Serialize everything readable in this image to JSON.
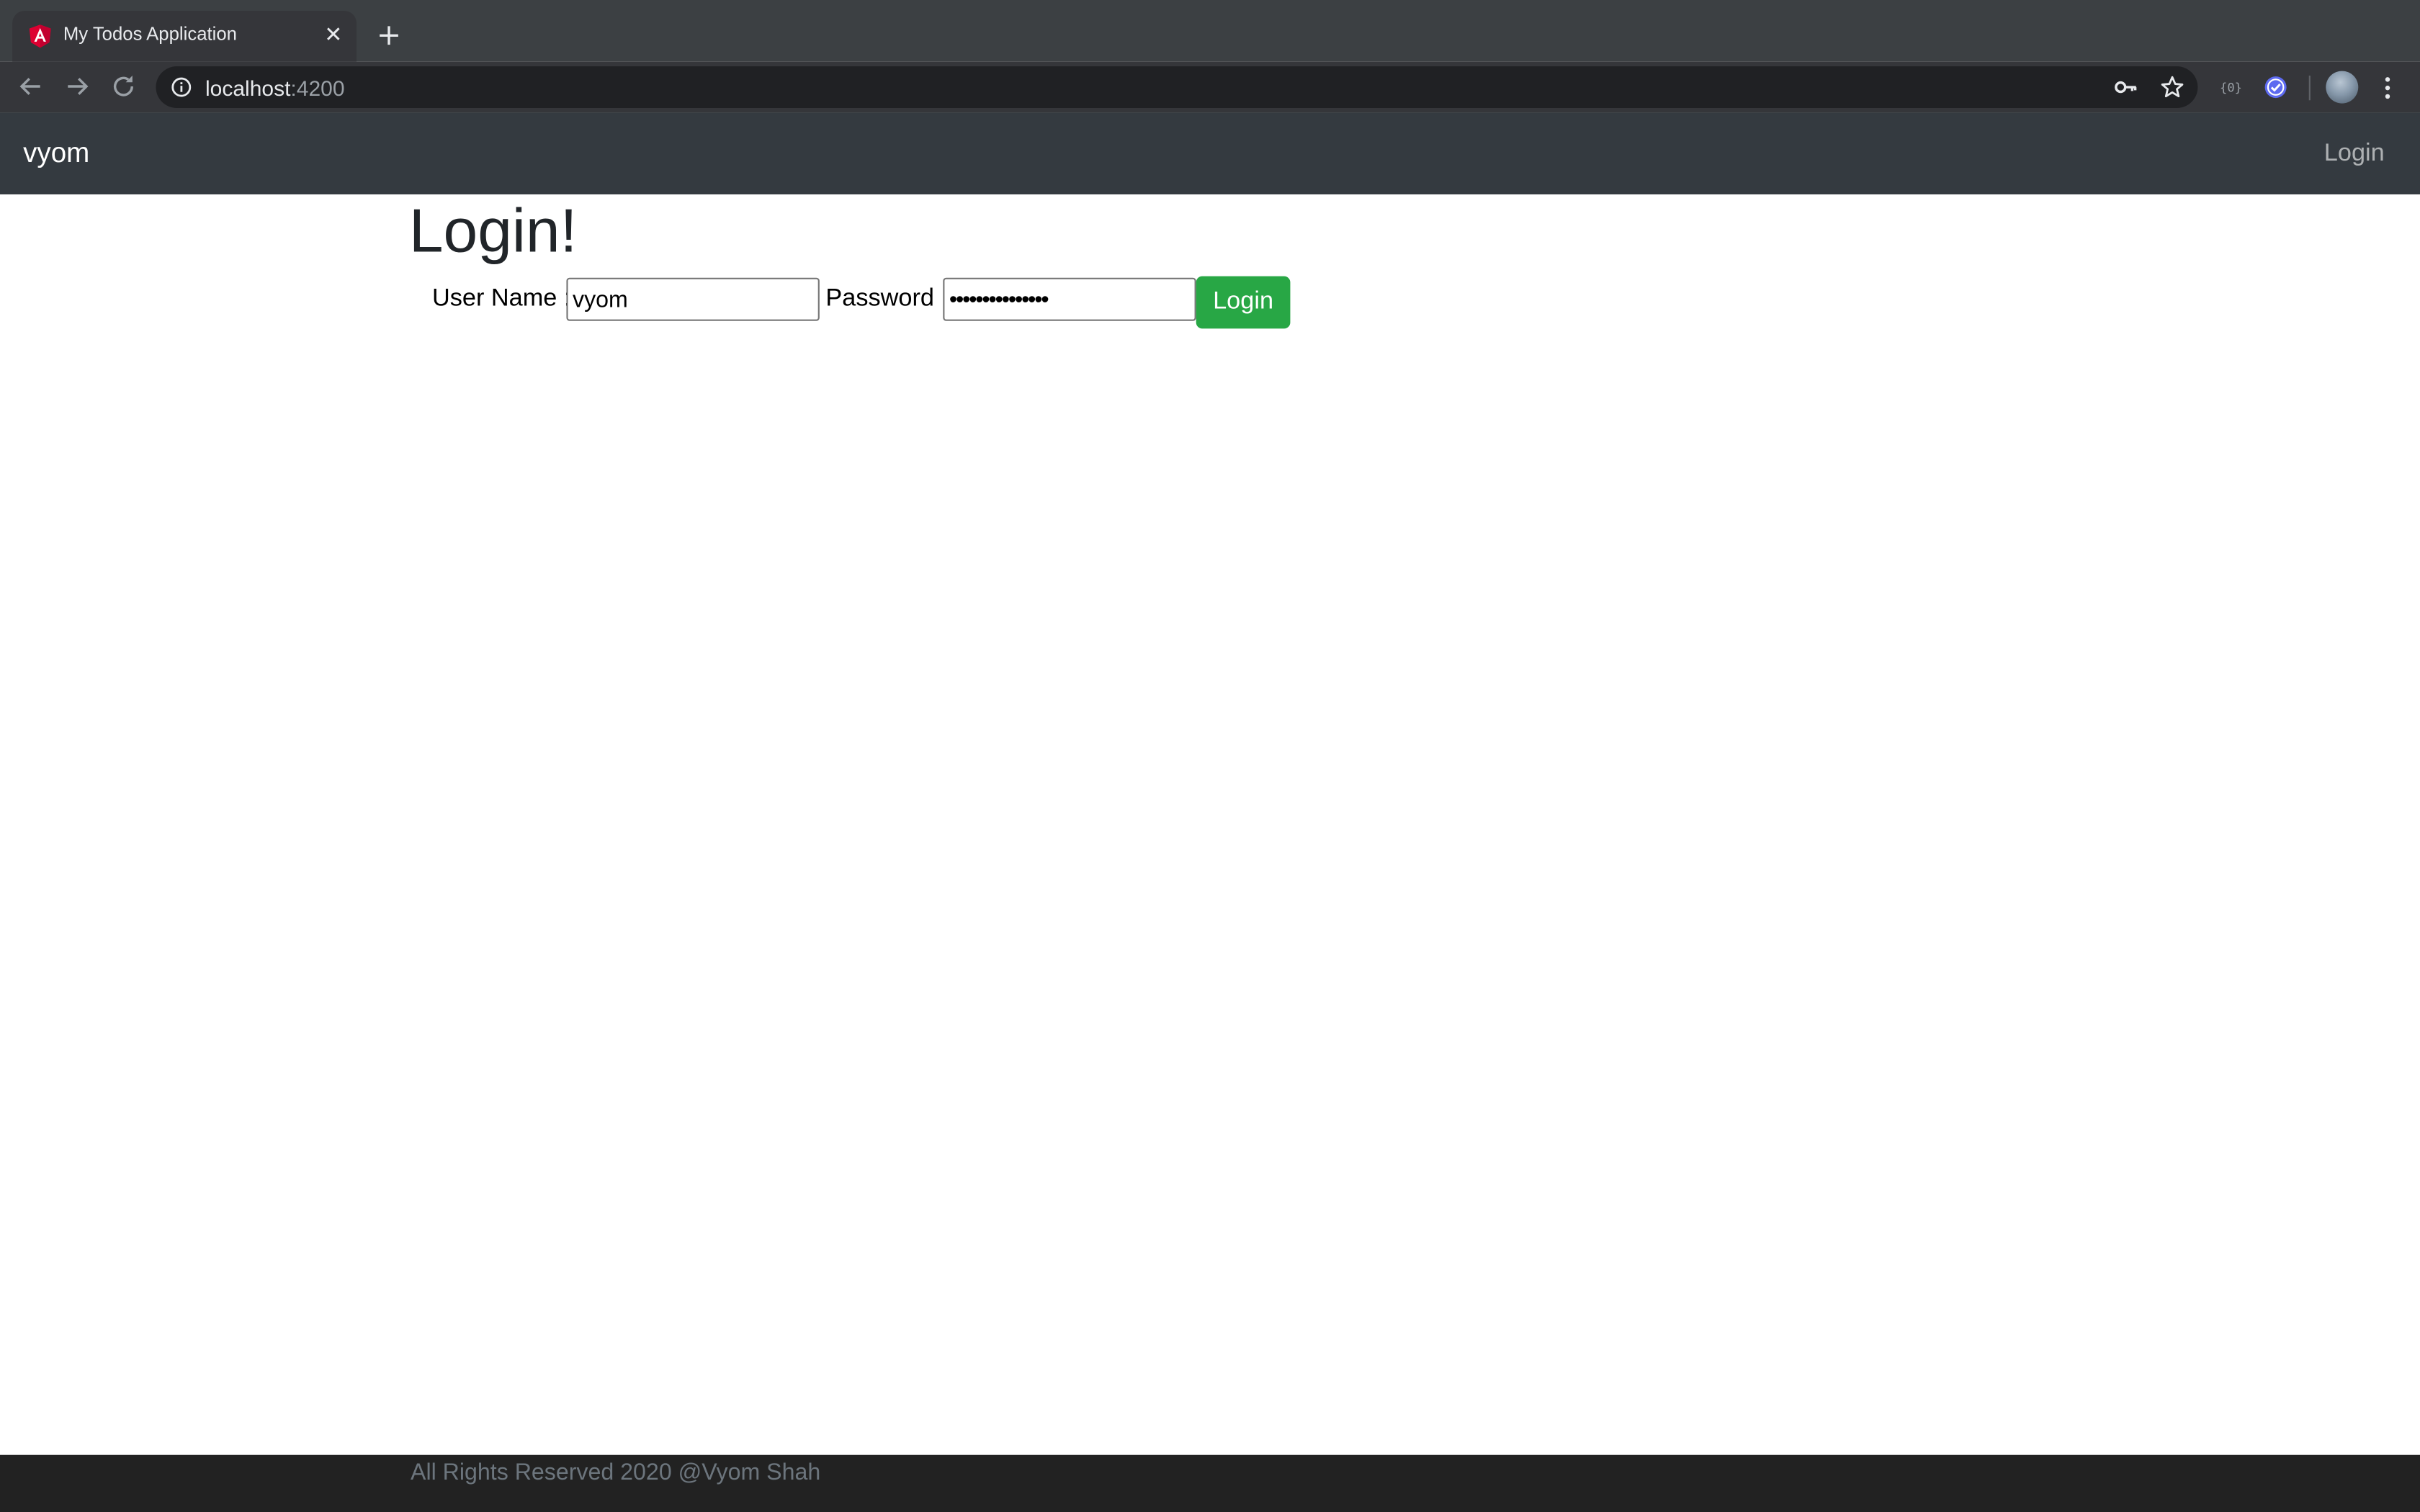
{
  "browser": {
    "tab": {
      "title": "My Todos Application",
      "favicon": "angular-icon",
      "close_symbol": "✕"
    },
    "new_tab_icon": "plus-icon",
    "url_host": "localhost",
    "url_port": ":4200",
    "icons": {
      "back": "arrow-left-icon",
      "forward": "arrow-right-icon",
      "reload": "reload-icon",
      "site_info": "info-icon",
      "password": "key-icon",
      "bookmark": "star-icon",
      "extension_1": "extension-brackets-icon",
      "extension_2": "check-badge-icon",
      "profile": "avatar",
      "menu": "more-vert-icon"
    }
  },
  "navbar": {
    "brand": "vyom",
    "login_link": "Login"
  },
  "main": {
    "title": "Login!",
    "form": {
      "username_label": "User Name :",
      "username_value": "vyom",
      "password_label": "Password :",
      "password_value": "•••••••••••••••",
      "submit_label": "Login"
    }
  },
  "footer": {
    "text": "All Rights Reserved 2020 @Vyom Shah"
  },
  "colors": {
    "chrome_tabbar": "#3c4043",
    "chrome_toolbar": "#35363a",
    "omnibox": "#202124",
    "navbar": "#343a40",
    "success": "#28a745",
    "footer": "#222222",
    "footer_text": "#6c757d"
  }
}
